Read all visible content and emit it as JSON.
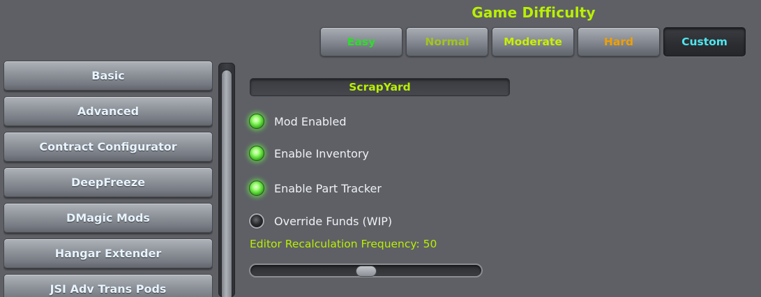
{
  "difficulty": {
    "title": "Game Difficulty",
    "options": [
      {
        "label": "Easy",
        "color": "#2dde2d",
        "active": false
      },
      {
        "label": "Normal",
        "color": "#a2c51e",
        "active": false
      },
      {
        "label": "Moderate",
        "color": "#c8f000",
        "active": false
      },
      {
        "label": "Hard",
        "color": "#f0a000",
        "active": false
      },
      {
        "label": "Custom",
        "color": "#4fe6ef",
        "active": true
      }
    ]
  },
  "sidebar": {
    "items": [
      {
        "label": "Basic"
      },
      {
        "label": "Advanced"
      },
      {
        "label": "Contract Configurator"
      },
      {
        "label": "DeepFreeze"
      },
      {
        "label": "DMagic Mods"
      },
      {
        "label": "Hangar Extender"
      },
      {
        "label": "JSI Adv Trans Pods"
      }
    ]
  },
  "panel": {
    "section_title": "ScrapYard",
    "toggles": [
      {
        "label": "Mod Enabled",
        "checked": true
      },
      {
        "label": "Enable Inventory",
        "checked": true
      },
      {
        "label": "Enable Part Tracker",
        "checked": true
      },
      {
        "label": "Override Funds (WIP)",
        "checked": false
      }
    ],
    "frequency": {
      "label": "Editor Recalculation Frequency: 50",
      "value": 50,
      "min": 0,
      "max": 100
    }
  },
  "colors": {
    "accent": "#b9f000",
    "background": "#5e6066",
    "led_on": "#52d430"
  }
}
